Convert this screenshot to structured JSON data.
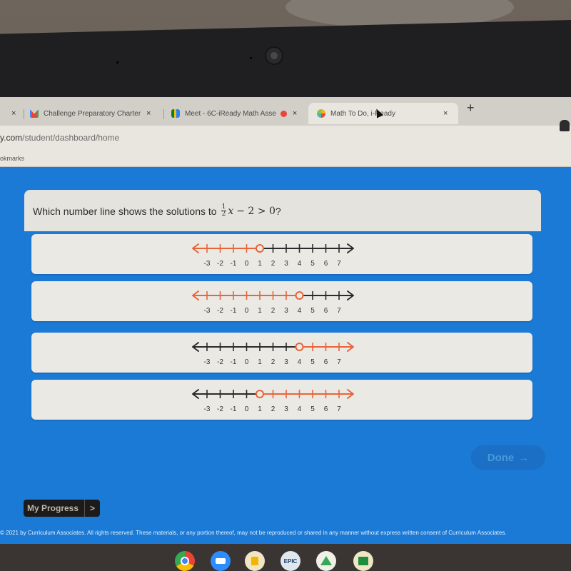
{
  "browser": {
    "tabs": [
      {
        "title": "",
        "close_icon": "×",
        "favicon": "none"
      },
      {
        "title": "Challenge Preparatory Charter S",
        "close_icon": "×",
        "favicon": "gmail-icon"
      },
      {
        "title": "Meet - 6C-iReady Math Asse",
        "close_icon": "×",
        "favicon": "google-meet-icon",
        "recording": true
      },
      {
        "title": "Math To Do, i-Ready",
        "close_icon": "×",
        "favicon": "iready-icon",
        "active": true
      }
    ],
    "new_tab_icon": "+",
    "url_host": "y.com",
    "url_path": "/student/dashboard/home",
    "bookmarks_label": "okmarks"
  },
  "question": {
    "prompt": "Which number line shows the solutions to",
    "expression": {
      "frac_num": "1",
      "frac_den": "2",
      "variable": "x",
      "rest": "− 2 > 0",
      "end": "?"
    }
  },
  "number_line": {
    "ticks": [
      -3,
      -2,
      -1,
      0,
      1,
      2,
      3,
      4,
      5,
      6,
      7
    ],
    "tick_labels": [
      "-3",
      "-2",
      "-1",
      "0",
      "1",
      "2",
      "3",
      "4",
      "5",
      "6",
      "7"
    ],
    "shade_color": "#e8643a",
    "base_color": "#2b2b2b"
  },
  "choices": [
    {
      "point": 1,
      "open": true,
      "direction": "left"
    },
    {
      "point": 4,
      "open": true,
      "direction": "left"
    },
    {
      "point": 4,
      "open": true,
      "direction": "right"
    },
    {
      "point": 1,
      "open": true,
      "direction": "right"
    }
  ],
  "done_button": {
    "label": "Done",
    "icon": "→"
  },
  "my_progress": {
    "label": "My Progress",
    "chevron": ">"
  },
  "footer": {
    "copyright": "© 2021 by Curriculum Associates. All rights reserved. These materials, or any portion thereof, may not be reproduced or shared in any manner without express written consent of Curriculum Associates."
  },
  "shelf": {
    "apps": [
      "chrome-icon",
      "zoom-icon",
      "google-slides-icon",
      "epic-icon",
      "google-drive-icon",
      "google-classroom-icon"
    ],
    "epic_label": "EPIC"
  },
  "colors": {
    "page_bg": "#1a7ad6",
    "card_bg": "#ebe9e4",
    "accent_orange": "#e8643a"
  }
}
